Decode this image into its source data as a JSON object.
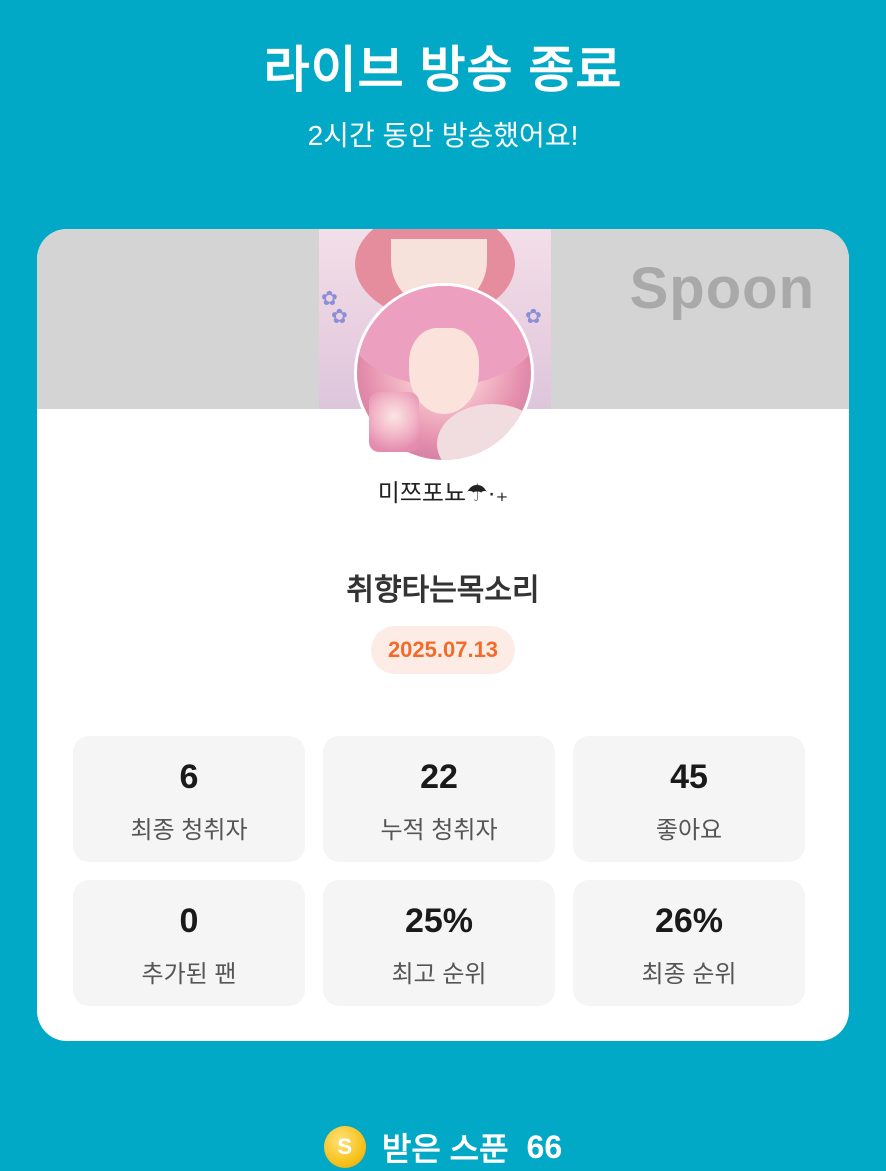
{
  "header": {
    "title": "라이브 방송 종료",
    "subtitle": "2시간 동안 방송했어요!"
  },
  "card": {
    "brand": "Spoon",
    "nickname": "미쯔포뇨☂︎·₊",
    "room_title": "취향타는목소리",
    "date": "2025.07.13",
    "stats": [
      {
        "value": "6",
        "label": "최종 청취자"
      },
      {
        "value": "22",
        "label": "누적 청취자"
      },
      {
        "value": "45",
        "label": "좋아요"
      },
      {
        "value": "0",
        "label": "추가된 팬"
      },
      {
        "value": "25%",
        "label": "최고 순위"
      },
      {
        "value": "26%",
        "label": "최종 순위"
      }
    ]
  },
  "footer": {
    "coin_symbol": "S",
    "spoon_label": "받은 스푼",
    "spoon_count": "66"
  },
  "colors": {
    "background": "#01a9c6",
    "date_accent": "#f26b2a",
    "coin": "#f7c21c"
  },
  "icons": {
    "coin": "spoon-coin-icon",
    "flowers": "flower-icon"
  }
}
